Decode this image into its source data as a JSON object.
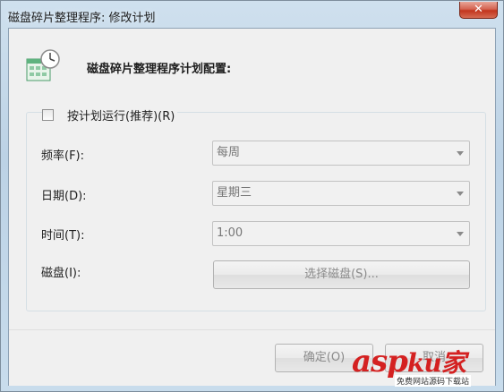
{
  "window": {
    "title": "磁盘碎片整理程序: 修改计划",
    "close_label": "✕"
  },
  "header": {
    "text": "磁盘碎片整理程序计划配置:"
  },
  "schedule": {
    "checkbox_label": "按计划运行(推荐)(R)",
    "checked": false
  },
  "form": {
    "frequency_label": "频率(F):",
    "frequency_value": "每周",
    "date_label": "日期(D):",
    "date_value": "星期三",
    "time_label": "时间(T):",
    "time_value": "1:00",
    "disk_label": "磁盘(I):",
    "disk_button": "选择磁盘(S)..."
  },
  "footer": {
    "ok_button": "确定(O)",
    "cancel_button": "取消"
  },
  "watermark": {
    "text": "asp",
    "text2": "ku",
    "text3": "家",
    "sub": "免费网站源码下载站"
  },
  "icons": {
    "header": "calendar-clock-icon",
    "dropdown": "chevron-down-icon"
  }
}
